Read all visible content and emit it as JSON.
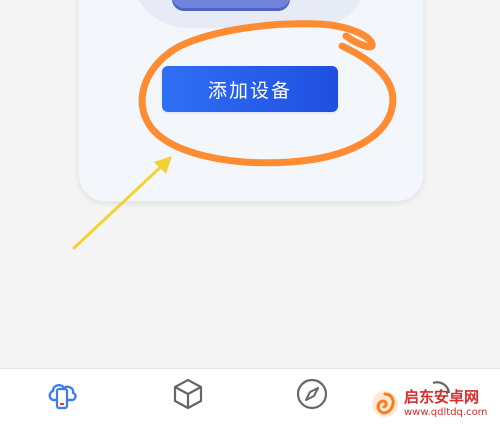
{
  "main": {
    "add_device_label": "添加设备"
  },
  "tabs": [
    {
      "label": "",
      "icon": "cloud-phone-icon",
      "active": true
    },
    {
      "label": "",
      "icon": "cube-icon",
      "active": false
    },
    {
      "label": "",
      "icon": "compass-icon",
      "active": false
    },
    {
      "label": "",
      "icon": "profile-icon",
      "active": false
    }
  ],
  "watermark": {
    "name": "启东安卓网",
    "url": "www.qdltdq.com"
  },
  "colors": {
    "button_gradient_start": "#2f6ff5",
    "button_gradient_end": "#1f4fe0",
    "annotation_circle": "#ff8c33",
    "annotation_arrow": "#f5d234",
    "tab_active": "#3a7df0",
    "watermark": "#d62c2c"
  }
}
